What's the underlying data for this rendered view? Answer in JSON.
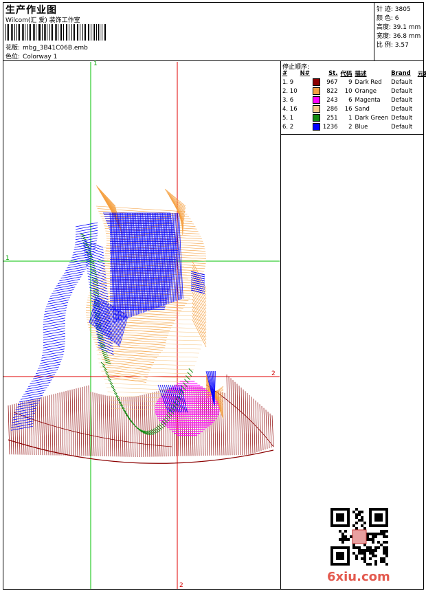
{
  "header": {
    "title": "生产作业图",
    "studio": "Wilcom(汇 爱) 装饰工作室",
    "design_label": "花版:",
    "design_file": "mbg_3B41C06B.emb",
    "colorway_label": "色位:",
    "colorway": "Colorway 1"
  },
  "stats": {
    "stitches": "针 迹: 3805",
    "colors": "颜 色: 6",
    "height": "高度: 39.1 mm",
    "width": "宽度: 36.8 mm",
    "scale": "比 例: 3.57"
  },
  "stop_sequence": {
    "title": "停止顺序:",
    "headers": [
      "#",
      "N#",
      "",
      "St.",
      "代码",
      "描述",
      "Brand",
      "元素"
    ],
    "rows": [
      {
        "idx": "1. 9",
        "color": "#8b0000",
        "stitches": "967",
        "code": "9",
        "desc": "Dark Red",
        "brand": "Default"
      },
      {
        "idx": "2. 10",
        "color": "#f5a040",
        "stitches": "822",
        "code": "10",
        "desc": "Orange",
        "brand": "Default"
      },
      {
        "idx": "3. 6",
        "color": "#ff00ff",
        "stitches": "243",
        "code": "6",
        "desc": "Magenta",
        "brand": "Default"
      },
      {
        "idx": "4. 16",
        "color": "#f7c98a",
        "stitches": "286",
        "code": "16",
        "desc": "Sand",
        "brand": "Default"
      },
      {
        "idx": "5. 1",
        "color": "#118a11",
        "stitches": "251",
        "code": "1",
        "desc": "Dark Green",
        "brand": "Default"
      },
      {
        "idx": "6. 2",
        "color": "#0000ff",
        "stitches": "1236",
        "code": "2",
        "desc": "Blue",
        "brand": "Default"
      }
    ]
  },
  "axes": {
    "green_top": "1",
    "green_left": "1",
    "red_right": "2",
    "red_bottom": "2"
  },
  "watermark": "6xiu.com"
}
